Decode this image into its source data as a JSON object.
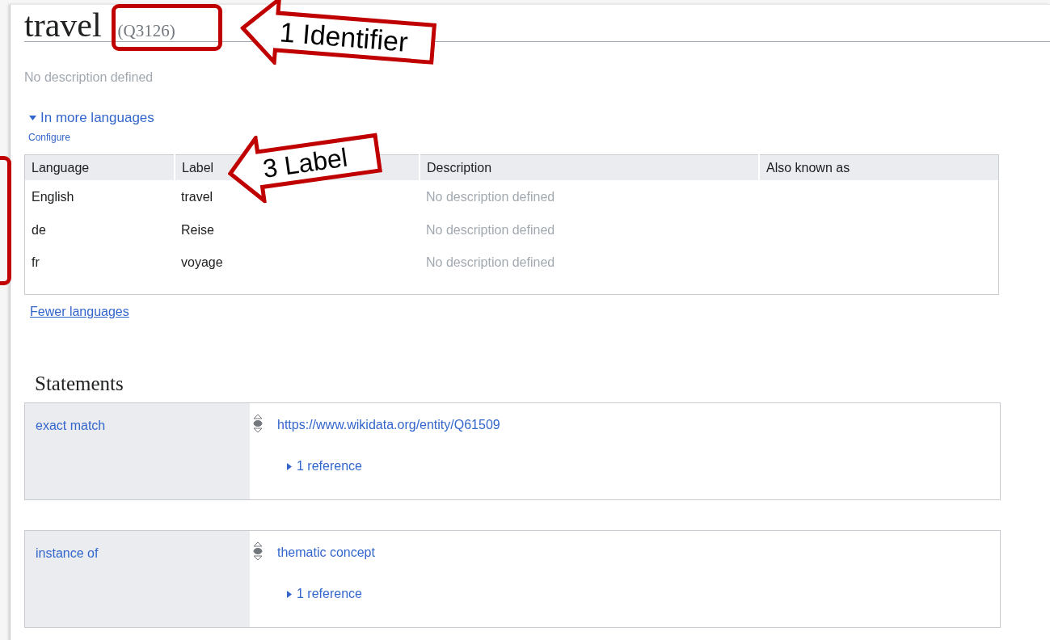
{
  "title": {
    "label": "travel",
    "id": "(Q3126)"
  },
  "description": "No description defined",
  "languages": {
    "toggle": "In more languages",
    "expanded": true,
    "configure": "Configure",
    "columns": [
      "Language",
      "Label",
      "Description",
      "Also known as"
    ],
    "rows": [
      {
        "language": "English",
        "label": "travel",
        "description": "No description defined",
        "missing": true
      },
      {
        "language": "de",
        "label": "Reise",
        "description": "No description defined",
        "missing": true
      },
      {
        "language": "fr",
        "label": "voyage",
        "description": "No description defined",
        "missing": true
      }
    ],
    "fewer": "Fewer languages"
  },
  "statements": {
    "heading": "Statements",
    "items": [
      {
        "property": "exact match",
        "value": "https://www.wikidata.org/entity/Q61509",
        "references": {
          "label": "1 reference",
          "expanded": false
        }
      },
      {
        "property": "instance of",
        "value": "thematic concept",
        "references": {
          "label": "1 reference",
          "expanded": false
        }
      }
    ]
  },
  "annotations": [
    {
      "kind": "frame"
    },
    {
      "kind": "arrow",
      "text": "1 Identifier"
    },
    {
      "kind": "arrow",
      "text": "3 Label"
    },
    {
      "kind": "frame"
    }
  ]
}
